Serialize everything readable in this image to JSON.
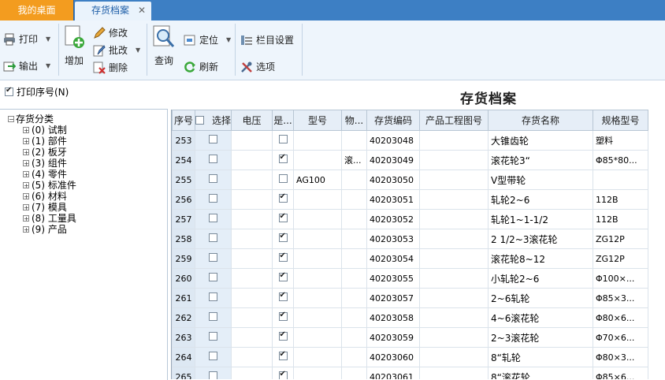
{
  "tabs": {
    "home": "我的桌面",
    "active": "存货档案",
    "close": "✕"
  },
  "toolbar": {
    "print": "打印",
    "export": "输出",
    "add": "增加",
    "edit": "修改",
    "batch_edit": "批改",
    "delete": "删除",
    "query": "查询",
    "locate": "定位",
    "refresh": "刷新",
    "column_settings": "栏目设置",
    "options": "选项"
  },
  "print_seq": {
    "label": "打印序号(N)",
    "checked": true
  },
  "page_title": "存货档案",
  "tree": {
    "root": "存货分类",
    "items": [
      "(0) 试制",
      "(1) 部件",
      "(2) 板牙",
      "(3) 组件",
      "(4) 零件",
      "(5) 标准件",
      "(6) 材料",
      "(7) 模具",
      "(8) 工量具",
      "(9) 产品"
    ]
  },
  "table": {
    "headers": [
      "序号",
      "选择",
      "电压",
      "是...",
      "型号",
      "物...",
      "存货编码",
      "产品工程图号",
      "存货名称",
      "规格型号"
    ],
    "rows": [
      {
        "seq": "253",
        "sel": false,
        "voltage": "",
        "flag": false,
        "model": "",
        "wu": "",
        "code": "40203048",
        "drawing": "",
        "name": "大锥齿轮",
        "spec": "塑料"
      },
      {
        "seq": "254",
        "sel": false,
        "voltage": "",
        "flag": true,
        "model": "",
        "wu": "滚...",
        "code": "40203049",
        "drawing": "",
        "name": "滚花轮3“",
        "spec": "Φ85*80..."
      },
      {
        "seq": "255",
        "sel": false,
        "voltage": "",
        "flag": false,
        "model": "AG100",
        "wu": "",
        "code": "40203050",
        "drawing": "",
        "name": "V型带轮",
        "spec": ""
      },
      {
        "seq": "256",
        "sel": false,
        "voltage": "",
        "flag": true,
        "model": "",
        "wu": "",
        "code": "40203051",
        "drawing": "",
        "name": "轧轮2~6",
        "spec": "112B"
      },
      {
        "seq": "257",
        "sel": false,
        "voltage": "",
        "flag": true,
        "model": "",
        "wu": "",
        "code": "40203052",
        "drawing": "",
        "name": "轧轮1~1-1/2",
        "spec": "112B"
      },
      {
        "seq": "258",
        "sel": false,
        "voltage": "",
        "flag": true,
        "model": "",
        "wu": "",
        "code": "40203053",
        "drawing": "",
        "name": "2 1/2~3滚花轮",
        "spec": "ZG12P"
      },
      {
        "seq": "259",
        "sel": false,
        "voltage": "",
        "flag": true,
        "model": "",
        "wu": "",
        "code": "40203054",
        "drawing": "",
        "name": "滚花轮8~12",
        "spec": "ZG12P"
      },
      {
        "seq": "260",
        "sel": false,
        "voltage": "",
        "flag": true,
        "model": "",
        "wu": "",
        "code": "40203055",
        "drawing": "",
        "name": "小轧轮2~6",
        "spec": "Φ100×..."
      },
      {
        "seq": "261",
        "sel": false,
        "voltage": "",
        "flag": true,
        "model": "",
        "wu": "",
        "code": "40203057",
        "drawing": "",
        "name": "2~6轧轮",
        "spec": "Φ85×3..."
      },
      {
        "seq": "262",
        "sel": false,
        "voltage": "",
        "flag": true,
        "model": "",
        "wu": "",
        "code": "40203058",
        "drawing": "",
        "name": "4~6滚花轮",
        "spec": "Φ80×6..."
      },
      {
        "seq": "263",
        "sel": false,
        "voltage": "",
        "flag": true,
        "model": "",
        "wu": "",
        "code": "40203059",
        "drawing": "",
        "name": "2~3滚花轮",
        "spec": "Φ70×6..."
      },
      {
        "seq": "264",
        "sel": false,
        "voltage": "",
        "flag": true,
        "model": "",
        "wu": "",
        "code": "40203060",
        "drawing": "",
        "name": "8“轧轮",
        "spec": "Φ80×3..."
      },
      {
        "seq": "265",
        "sel": false,
        "voltage": "",
        "flag": true,
        "model": "",
        "wu": "",
        "code": "40203061",
        "drawing": "",
        "name": "8“滚花轮",
        "spec": "Φ85×6..."
      }
    ]
  }
}
